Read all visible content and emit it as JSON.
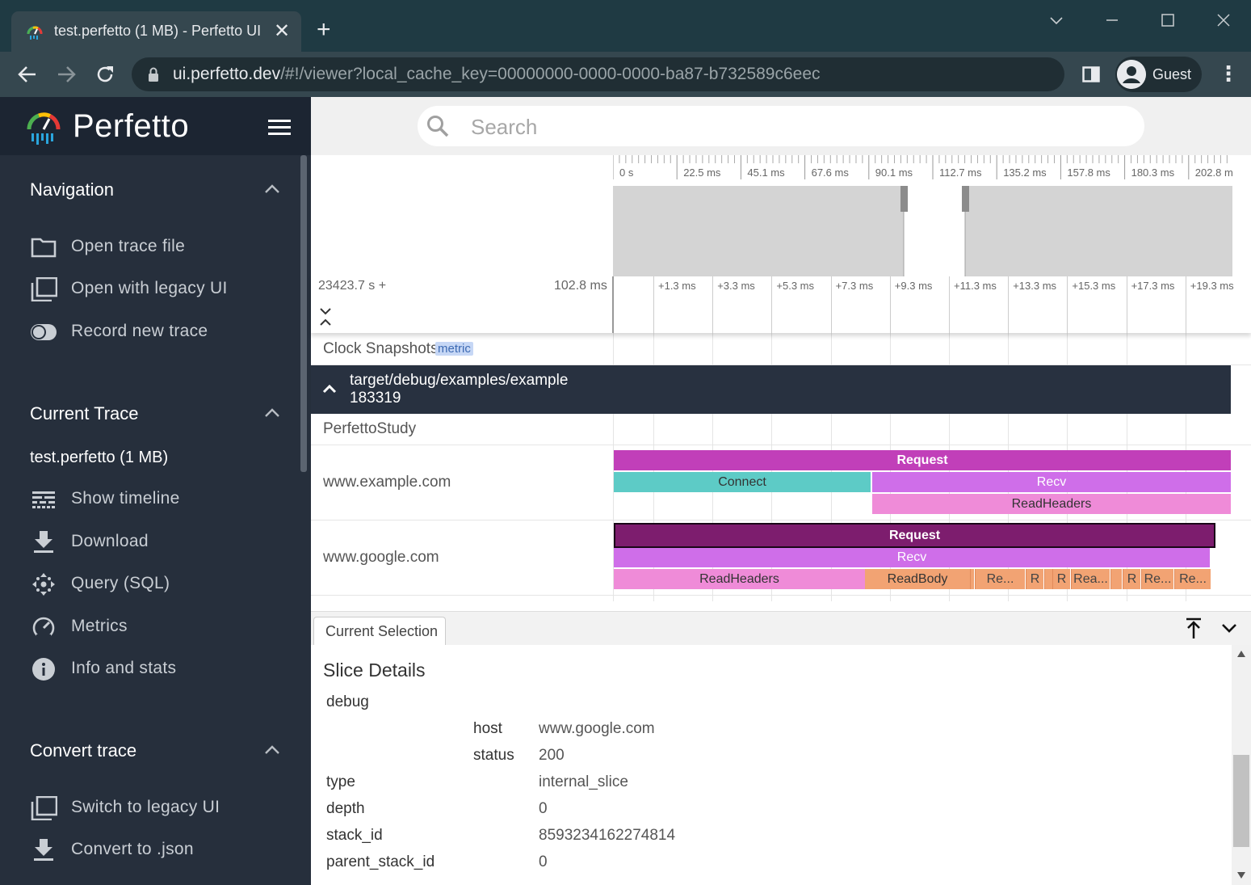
{
  "browser": {
    "tab_title": "test.perfetto (1 MB) - Perfetto UI",
    "tab_close": "✕",
    "new_tab": "+",
    "url_host": "ui.perfetto.dev",
    "url_path": "/#!/viewer?local_cache_key=00000000-0000-0000-ba87-b732589c6eec",
    "profile_label": "Guest",
    "window_controls": [
      "minimize",
      "maximize",
      "close"
    ],
    "menu_glyph": "⋮"
  },
  "sidebar": {
    "brand": "Perfetto",
    "sections": [
      {
        "title": "Navigation",
        "items": [
          {
            "label": "Open trace file",
            "icon": "folder-icon"
          },
          {
            "label": "Open with legacy UI",
            "icon": "filter-none-icon"
          },
          {
            "label": "Record new trace",
            "icon": "toggle-icon"
          }
        ]
      },
      {
        "title": "Current Trace",
        "trace_name": "test.perfetto (1 MB)",
        "items": [
          {
            "label": "Show timeline",
            "icon": "timeline-icon"
          },
          {
            "label": "Download",
            "icon": "download-icon"
          },
          {
            "label": "Query (SQL)",
            "icon": "query-icon"
          },
          {
            "label": "Metrics",
            "icon": "speedometer-icon"
          },
          {
            "label": "Info and stats",
            "icon": "info-icon"
          }
        ]
      },
      {
        "title": "Convert trace",
        "items": [
          {
            "label": "Switch to legacy UI",
            "icon": "filter-none-icon"
          },
          {
            "label": "Convert to .json",
            "icon": "download-icon"
          }
        ]
      }
    ]
  },
  "search": {
    "placeholder": "Search"
  },
  "overview": {
    "tick_labels": [
      "0 s",
      "22.5 ms",
      "45.1 ms",
      "67.6 ms",
      "90.1 ms",
      "112.7 ms",
      "135.2 ms",
      "157.8 ms",
      "180.3 ms",
      "202.8 m"
    ]
  },
  "timeline": {
    "offset_label": "23423.7 s +",
    "span_label": "102.8 ms",
    "tick_labels": [
      "+1.3 ms",
      "+3.3 ms",
      "+5.3 ms",
      "+7.3 ms",
      "+9.3 ms",
      "+11.3 ms",
      "+13.3 ms",
      "+15.3 ms",
      "+17.3 ms",
      "+19.3 ms"
    ]
  },
  "tracks": {
    "clock_snapshots": {
      "name": "Clock Snapshots",
      "badge": "metric"
    },
    "group": {
      "name_line1": "target/debug/examples/example",
      "name_line2": "183319"
    },
    "perfetto_study": {
      "name": "PerfettoStudy"
    },
    "example_com": {
      "name": "www.example.com",
      "slices": [
        "Request",
        "Connect",
        "Recv",
        "ReadHeaders"
      ]
    },
    "google_com": {
      "name": "www.google.com",
      "slices": [
        "Request",
        "Recv",
        "ReadHeaders",
        "ReadBody",
        "Re...",
        "R",
        "R",
        "Rea...",
        "R",
        "Re...",
        "Re..."
      ]
    }
  },
  "colors": {
    "request_example": "#c13fb9",
    "connect": "#5dcbc6",
    "recv": "#cf6ee9",
    "readheaders": "#ef8bd8",
    "request_google": "#7d1d6e",
    "readbody": "#f2a373"
  },
  "details": {
    "tab_label": "Current Selection",
    "heading": "Slice Details",
    "debug_label": "debug",
    "args": [
      {
        "key": "host",
        "value": "www.google.com"
      },
      {
        "key": "status",
        "value": "200"
      }
    ],
    "fields": [
      {
        "key": "type",
        "value": "internal_slice"
      },
      {
        "key": "depth",
        "value": "0"
      },
      {
        "key": "stack_id",
        "value": "8593234162274814"
      },
      {
        "key": "parent_stack_id",
        "value": "0"
      }
    ]
  }
}
